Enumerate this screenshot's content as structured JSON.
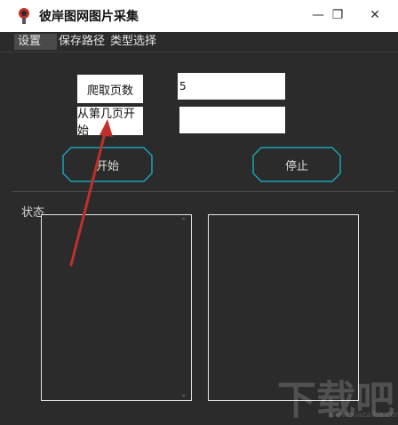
{
  "window": {
    "title": "彼岸图网图片采集",
    "controls": {
      "minimize": "—",
      "restore": "❐",
      "close": "✕"
    }
  },
  "menu": {
    "items": [
      "设置",
      "保存路径",
      "类型选择"
    ]
  },
  "form": {
    "pages_label": "爬取页数",
    "pages_value": "5",
    "start_page_label": "从第几页开始",
    "start_page_value": ""
  },
  "buttons": {
    "start": "开始",
    "stop": "停止"
  },
  "status": {
    "label": "状态"
  },
  "watermark": {
    "text": "下载吧",
    "url": "www.xiazaiba.com"
  },
  "colors": {
    "accent": "#1aa3b8",
    "annotation_arrow": "#c0302b"
  },
  "icons": {
    "app": "app-icon"
  }
}
